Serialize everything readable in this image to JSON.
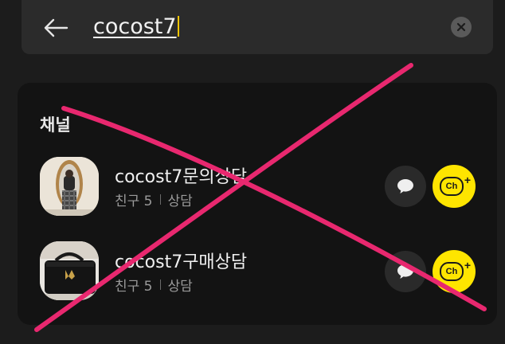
{
  "search": {
    "query": "cocost7"
  },
  "section": {
    "title": "채널"
  },
  "channels": [
    {
      "name": "cocost7문의상담",
      "friends_label": "친구 5",
      "type": "상담",
      "avatar_icon": "mirror-photo-avatar",
      "ch_label": "Ch",
      "ch_plus": "+"
    },
    {
      "name": "cocost7구매상담",
      "friends_label": "친구 5",
      "type": "상담",
      "avatar_icon": "handbag-photo-avatar",
      "ch_label": "Ch",
      "ch_plus": "+"
    }
  ],
  "colors": {
    "background": "#1c1c1c",
    "card": "#131313",
    "search_bar": "#2b2b2b",
    "accent_yellow": "#fee500",
    "caret": "#f5c400",
    "x_mark": "#e8286f"
  }
}
